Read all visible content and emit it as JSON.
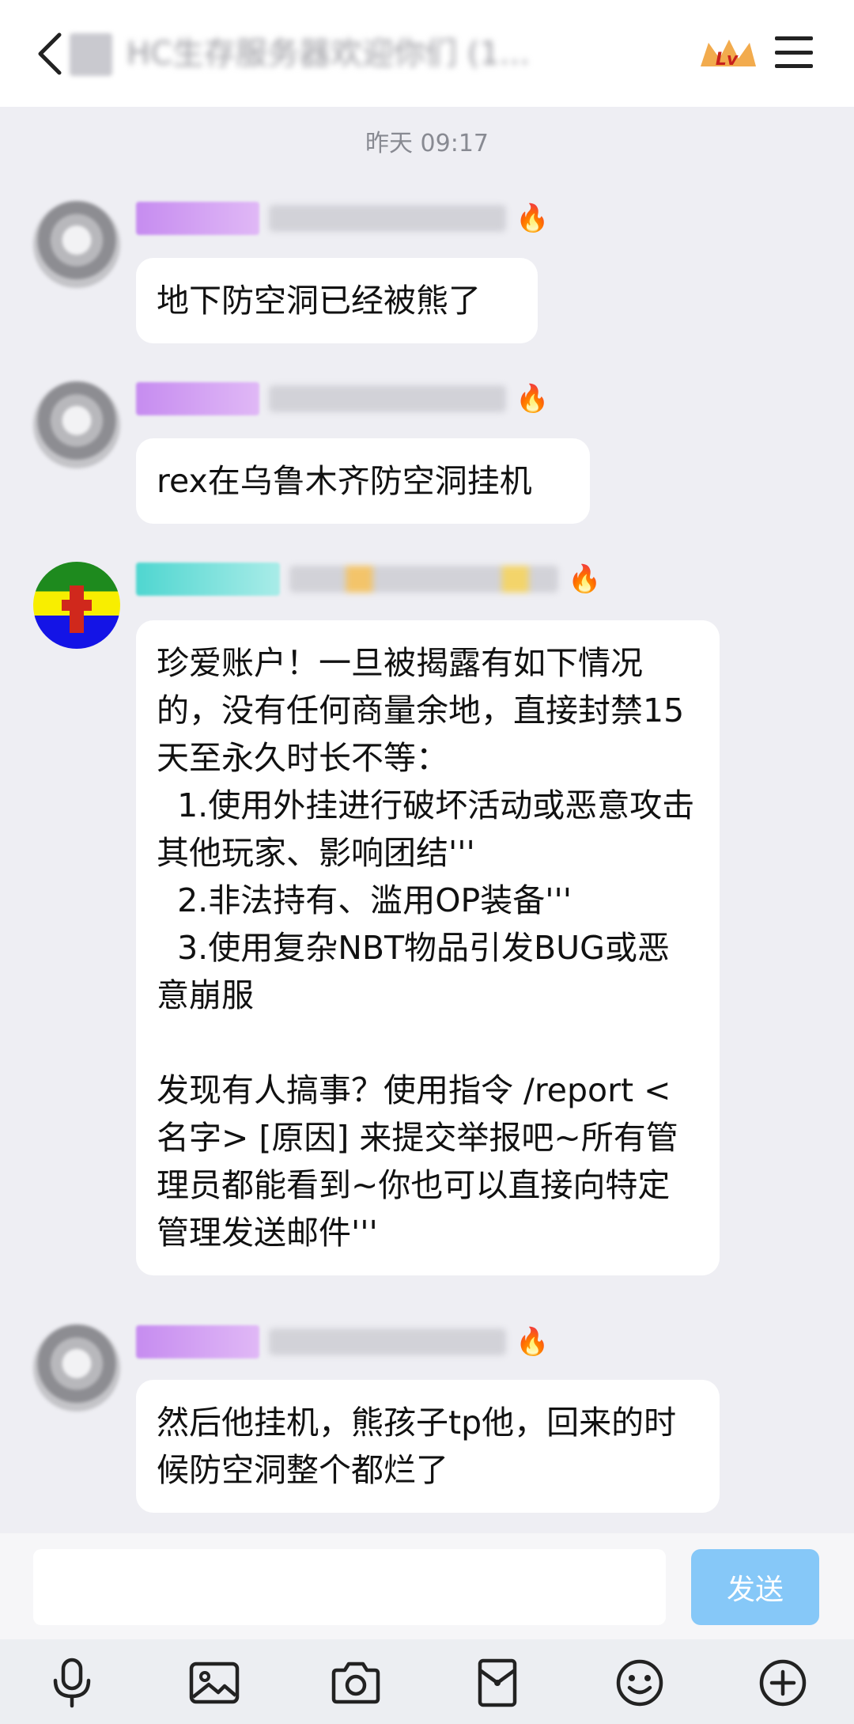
{
  "header": {
    "title": "HC生存服务器欢迎你们 (1..."
  },
  "timestamp": "昨天 09:17",
  "messages": [
    {
      "text": "地下防空洞已经被熊了"
    },
    {
      "text": "rex在乌鲁木齐防空洞挂机"
    },
    {
      "text": "珍爱账户！一旦被揭露有如下情况的，没有任何商量余地，直接封禁15天至永久时长不等：\n  1.使用外挂进行破坏活动或恶意攻击其他玩家、影响团结'''\n  2.非法持有、滥用OP装备'''\n  3.使用复杂NBT物品引发BUG或恶意崩服\n\n发现有人搞事？使用指令 /report <名字> [原因] 来提交举报吧~所有管理员都能看到~你也可以直接向特定管理发送邮件'''"
    },
    {
      "text": "然后他挂机，熊孩子tp他，回来的时候防空洞整个都烂了"
    }
  ],
  "composer": {
    "placeholder": "",
    "send_label": "发送"
  },
  "toolbar": {
    "icons": [
      "microphone-icon",
      "image-icon",
      "camera-icon",
      "red-packet-icon",
      "emoji-icon",
      "plus-icon"
    ]
  },
  "colors": {
    "background": "#eeeef3",
    "bubble": "#ffffff",
    "send_button": "#86c8f8"
  }
}
